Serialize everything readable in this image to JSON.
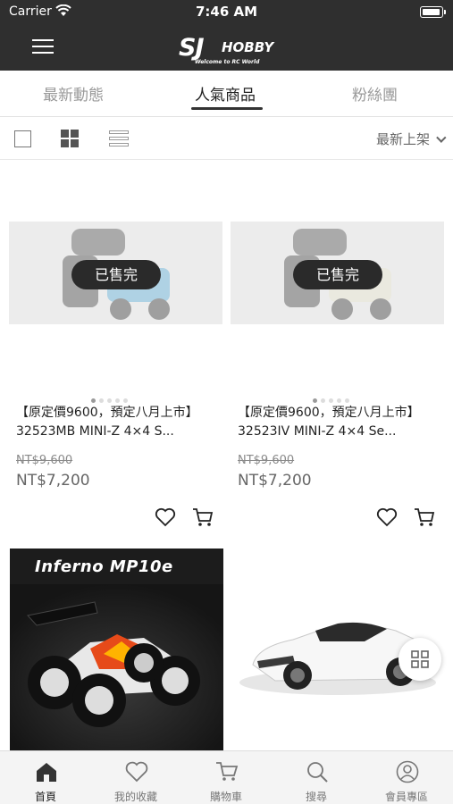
{
  "status": {
    "carrier": "Carrier",
    "time": "7:46 AM"
  },
  "header": {
    "logo_text": "SJ",
    "logo_sub": "HOBBY",
    "logo_tagline": "Welcome to RC World"
  },
  "tabs": [
    {
      "label": "最新動態",
      "active": false
    },
    {
      "label": "人氣商品",
      "active": true
    },
    {
      "label": "粉絲團",
      "active": false
    }
  ],
  "filter": {
    "sort_label": "最新上架"
  },
  "products": [
    {
      "sold_out_label": "已售完",
      "title": "【原定價9600，預定八月上市】32523MB MINI-Z 4×4 S...",
      "original_price": "NT$9,600",
      "price": "NT$7,200",
      "body_color": "#3fa3d6"
    },
    {
      "sold_out_label": "已售完",
      "title": "【原定價9600，預定八月上市】32523IV MINI-Z 4×4 Se...",
      "original_price": "NT$9,600",
      "price": "NT$7,200",
      "body_color": "#e9e4c8"
    },
    {
      "image_title": "Inferno MP10e"
    },
    {
      "image_alt_color": "#ffffff"
    }
  ],
  "bottom_nav": [
    {
      "label": "首頁",
      "icon": "home-icon",
      "active": true
    },
    {
      "label": "我的收藏",
      "icon": "heart-icon",
      "active": false
    },
    {
      "label": "購物車",
      "icon": "cart-icon",
      "active": false
    },
    {
      "label": "搜尋",
      "icon": "search-icon",
      "active": false
    },
    {
      "label": "會員專區",
      "icon": "user-icon",
      "active": false
    }
  ],
  "colors": {
    "header_bg": "#2f2f2f",
    "badge_bg": "#2a2a2a",
    "accent_text": "#222222"
  }
}
